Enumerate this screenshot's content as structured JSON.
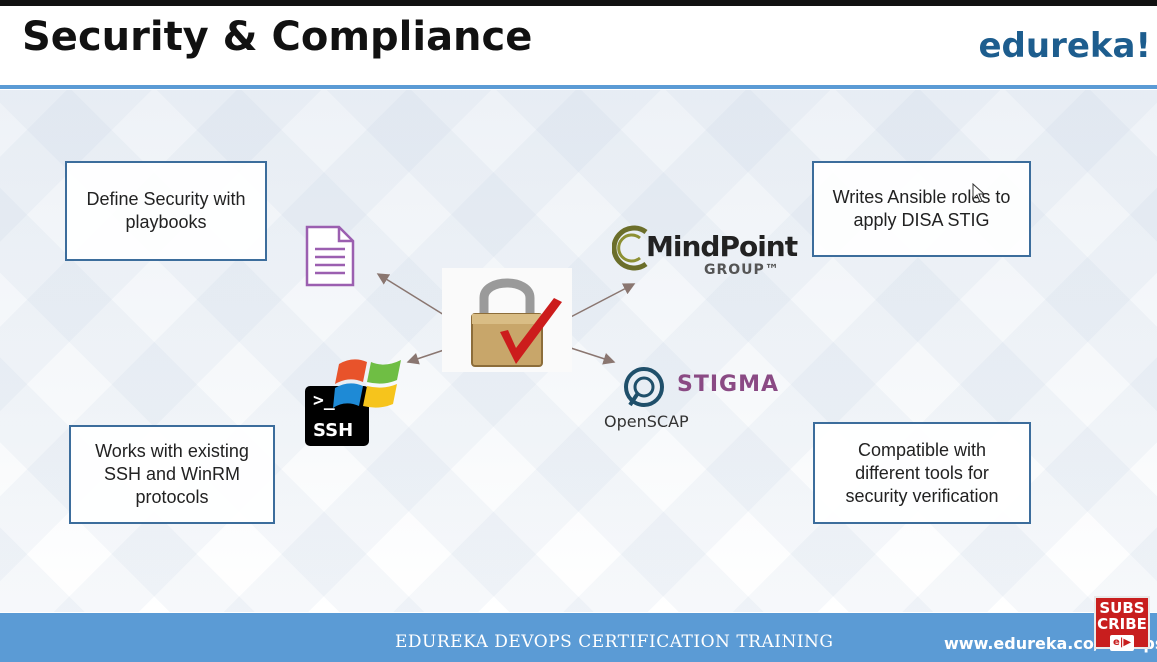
{
  "slide": {
    "title": "Security & Compliance",
    "brand": "edureka!",
    "boxes": {
      "top_left": "Define Security with playbooks",
      "top_right": "Writes Ansible roles to apply DISA STIG",
      "bottom_left": "Works with existing SSH and WinRM protocols",
      "bottom_right": "Compatible with different tools for security verification"
    },
    "logos": {
      "ssh_prompt": ">_",
      "ssh_label": "SSH",
      "mindpoint_name": "MindPoint",
      "mindpoint_sub": "GROUP™",
      "stigma": "STIGMA",
      "openscap": "OpenSCAP"
    },
    "footer": {
      "training": "EDUREKA DEVOPS CERTIFICATION TRAINING",
      "url": "www.edureka.co/devops"
    }
  },
  "overlay": {
    "subscribe_line1": "SUBS",
    "subscribe_line2": "CRIBE",
    "subscribe_logo": "e|▶"
  },
  "colors": {
    "accent": "#5b9bd5",
    "box_border": "#3c6d9c",
    "brand": "#1d5d8e",
    "stigma": "#8a4a84",
    "subscribe": "#c81e1e"
  },
  "icons": [
    "document-icon",
    "padlock-check-icon",
    "ssh-terminal-icon",
    "windows-logo-icon",
    "mindpoint-logo",
    "openscap-logo"
  ]
}
